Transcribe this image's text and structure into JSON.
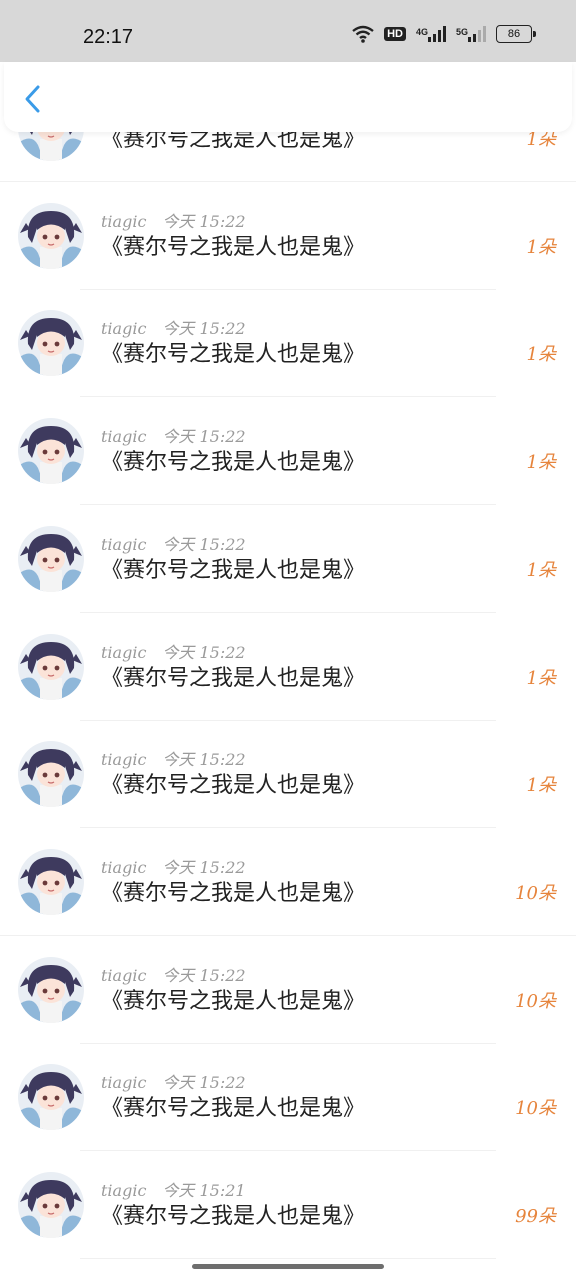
{
  "status_bar": {
    "time": "22:17",
    "hd_label": "HD",
    "net1": "4G",
    "net2": "5G",
    "battery": "86"
  },
  "header": {
    "back_icon": "chevron-left-icon",
    "accent_color": "#3a9be8"
  },
  "records": [
    {
      "user": "",
      "time": "",
      "title": "《赛尔号之我是人也是鬼》",
      "amount": "1朵"
    },
    {
      "user": "tiagic",
      "time": "今天 15:22",
      "title": "《赛尔号之我是人也是鬼》",
      "amount": "1朵"
    },
    {
      "user": "tiagic",
      "time": "今天 15:22",
      "title": "《赛尔号之我是人也是鬼》",
      "amount": "1朵"
    },
    {
      "user": "tiagic",
      "time": "今天 15:22",
      "title": "《赛尔号之我是人也是鬼》",
      "amount": "1朵"
    },
    {
      "user": "tiagic",
      "time": "今天 15:22",
      "title": "《赛尔号之我是人也是鬼》",
      "amount": "1朵"
    },
    {
      "user": "tiagic",
      "time": "今天 15:22",
      "title": "《赛尔号之我是人也是鬼》",
      "amount": "1朵"
    },
    {
      "user": "tiagic",
      "time": "今天 15:22",
      "title": "《赛尔号之我是人也是鬼》",
      "amount": "1朵"
    },
    {
      "user": "tiagic",
      "time": "今天 15:22",
      "title": "《赛尔号之我是人也是鬼》",
      "amount": "10朵"
    },
    {
      "user": "tiagic",
      "time": "今天 15:22",
      "title": "《赛尔号之我是人也是鬼》",
      "amount": "10朵"
    },
    {
      "user": "tiagic",
      "time": "今天 15:22",
      "title": "《赛尔号之我是人也是鬼》",
      "amount": "10朵"
    },
    {
      "user": "tiagic",
      "time": "今天 15:21",
      "title": "《赛尔号之我是人也是鬼》",
      "amount": "99朵"
    }
  ],
  "colors": {
    "amount": "#e6843c",
    "meta": "#9a9a9a",
    "title": "#222222"
  }
}
